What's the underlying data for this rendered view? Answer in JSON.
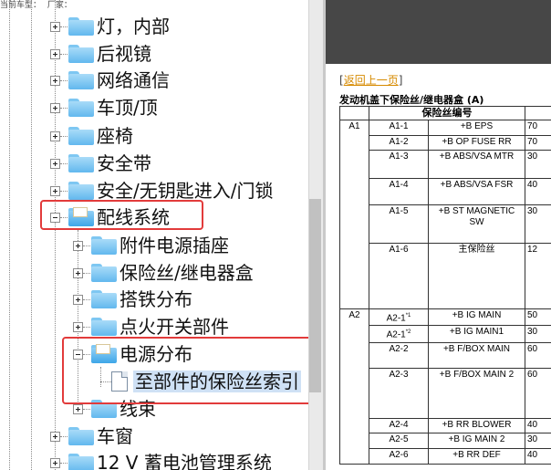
{
  "topbar": {
    "vehicle_label": "当前车型：",
    "maker_label": "厂家："
  },
  "tree": {
    "items": [
      {
        "label": "灯，内部",
        "expander": "plus"
      },
      {
        "label": "后视镜",
        "expander": "plus"
      },
      {
        "label": "网络通信",
        "expander": "plus"
      },
      {
        "label": "车顶/顶",
        "expander": "plus"
      },
      {
        "label": "座椅",
        "expander": "plus"
      },
      {
        "label": "安全带",
        "expander": "plus"
      },
      {
        "label": "安全/无钥匙进入/门锁",
        "expander": "plus"
      },
      {
        "label": "配线系统",
        "expander": "minus",
        "open": true,
        "highlighted": true
      },
      {
        "label": "附件电源插座",
        "expander": "plus"
      },
      {
        "label": "保险丝/继电器盒",
        "expander": "plus"
      },
      {
        "label": "搭铁分布",
        "expander": "plus"
      },
      {
        "label": "点火开关部件",
        "expander": "plus"
      },
      {
        "label": "电源分布",
        "expander": "minus",
        "open": true,
        "highlighted": true
      },
      {
        "label": "至部件的保险丝索引",
        "type": "document",
        "selected": true
      },
      {
        "label": "线束",
        "expander": "plus"
      },
      {
        "label": "车窗",
        "expander": "plus"
      },
      {
        "label": "12 V 蓄电池管理系统",
        "expander": "plus"
      }
    ]
  },
  "content": {
    "back_link": "返回上一页",
    "bracket_open": "[",
    "bracket_close": "]",
    "table_title": "发动机盖下保险丝/继电器盒 (A)",
    "table_header": "保险丝编号",
    "rows": [
      {
        "group": "A1",
        "id": "A1-1",
        "sup": "",
        "name": "+B EPS",
        "amp": "70"
      },
      {
        "group": "",
        "id": "A1-2",
        "sup": "",
        "name": "+B OP FUSE RR",
        "amp": "70"
      },
      {
        "group": "",
        "id": "A1-3",
        "sup": "",
        "name": "+B ABS/VSA MTR",
        "amp": "30"
      },
      {
        "group": "",
        "id": "A1-4",
        "sup": "",
        "name": "+B ABS/VSA FSR",
        "amp": "40"
      },
      {
        "group": "",
        "id": "A1-5",
        "sup": "",
        "name": "+B ST MAGNETIC SW",
        "amp": "30"
      },
      {
        "group": "",
        "id": "A1-6",
        "sup": "",
        "name": "主保险丝",
        "amp": "12"
      },
      {
        "group": "A2",
        "id": "A2-1",
        "sup": "*1",
        "name": "+B IG MAIN",
        "amp": "50"
      },
      {
        "group": "",
        "id": "A2-1",
        "sup": "*2",
        "name": "+B IG MAIN1",
        "amp": "30"
      },
      {
        "group": "",
        "id": "A2-2",
        "sup": "",
        "name": "+B F/BOX MAIN",
        "amp": "60"
      },
      {
        "group": "",
        "id": "A2-3",
        "sup": "",
        "name": "+B F/BOX MAIN 2",
        "amp": "60"
      },
      {
        "group": "",
        "id": "A2-4",
        "sup": "",
        "name": "+B RR BLOWER",
        "amp": "40"
      },
      {
        "group": "",
        "id": "A2-5",
        "sup": "",
        "name": "+B IG MAIN 2",
        "amp": "30"
      },
      {
        "group": "",
        "id": "A2-6",
        "sup": "",
        "name": "+B RR DEF",
        "amp": "40"
      }
    ]
  },
  "colors": {
    "highlight_box": "#e23b3b",
    "link": "#d68a00",
    "banner": "#474747",
    "selection": "#cfe1f5"
  }
}
